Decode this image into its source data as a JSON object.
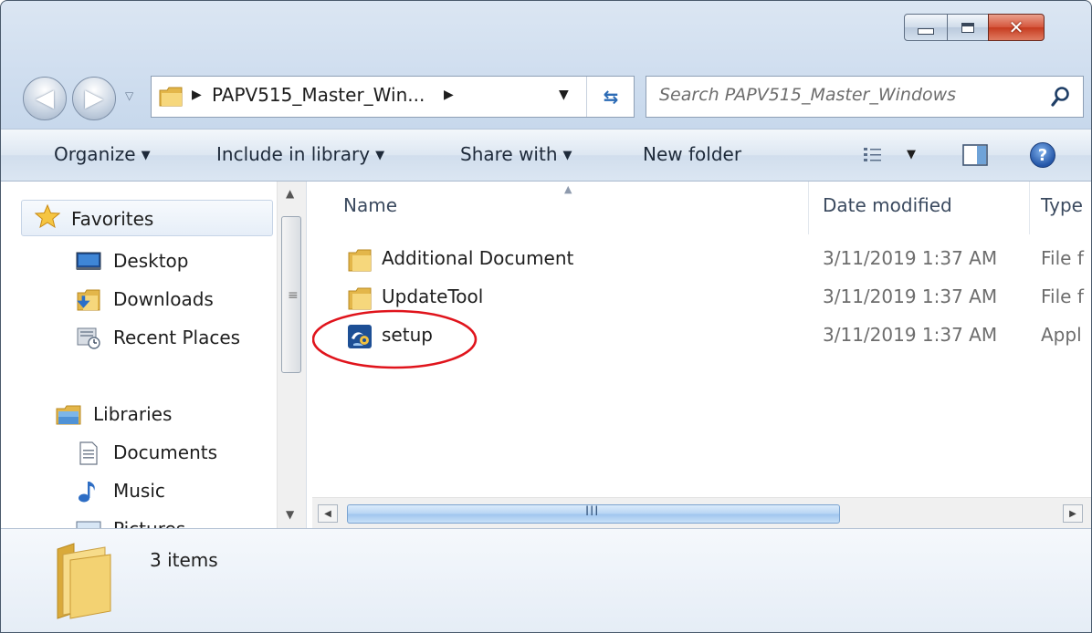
{
  "window": {
    "controls": {
      "minimize": "minimize",
      "maximize": "maximize",
      "close": "✕"
    }
  },
  "address": {
    "path_label": "PAPV515_Master_Win...",
    "search_placeholder": "Search PAPV515_Master_Windows"
  },
  "toolbar": {
    "organize": "Organize",
    "include_in_library": "Include in library",
    "share_with": "Share with",
    "new_folder": "New folder",
    "help": "?"
  },
  "sidebar": {
    "favorites": "Favorites",
    "desktop": "Desktop",
    "downloads": "Downloads",
    "recent_places": "Recent Places",
    "libraries": "Libraries",
    "documents": "Documents",
    "music": "Music",
    "pictures": "Pictures"
  },
  "file_list": {
    "columns": {
      "name": "Name",
      "date_modified": "Date modified",
      "type": "Type"
    },
    "rows": [
      {
        "name": "Additional Document",
        "date": "3/11/2019 1:37 AM",
        "type": "File f",
        "icon": "folder-icon"
      },
      {
        "name": "UpdateTool",
        "date": "3/11/2019 1:37 AM",
        "type": "File f",
        "icon": "folder-icon"
      },
      {
        "name": "setup",
        "date": "3/11/2019 1:37 AM",
        "type": "Appl",
        "icon": "setup-app-icon"
      }
    ]
  },
  "hscroll": {
    "grip": "III"
  },
  "details": {
    "item_count": "3 items"
  },
  "colors": {
    "chrome": "#c7d8ec",
    "accent_blue": "#2c6bb5",
    "annotation_red": "#e0141c"
  }
}
